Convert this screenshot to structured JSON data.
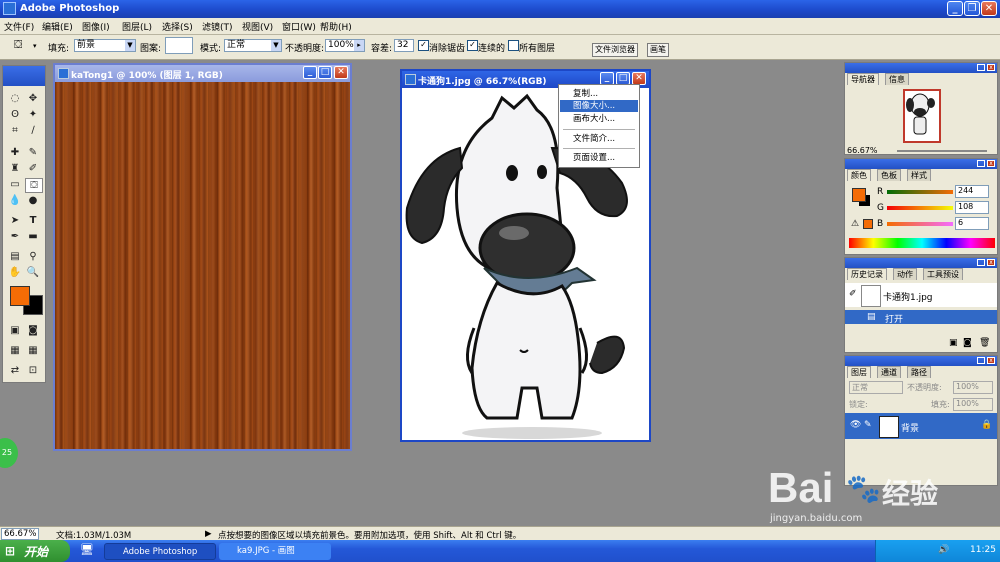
{
  "app": {
    "title": "Adobe Photoshop"
  },
  "menu": [
    "文件(F)",
    "编辑(E)",
    "图像(I)",
    "图层(L)",
    "选择(S)",
    "滤镜(T)",
    "视图(V)",
    "窗口(W)",
    "帮助(H)"
  ],
  "options": {
    "fill_label": "填充:",
    "fill_value": "前景",
    "pattern_label": "图案:",
    "mode_label": "模式:",
    "mode_value": "正常",
    "opacity_label": "不透明度:",
    "opacity_value": "100%",
    "tolerance_label": "容差:",
    "tolerance_value": "32",
    "antialias_label": "消除锯齿",
    "contiguous_label": "连续的",
    "all_layers_label": "所有图层",
    "tab_file_browser": "文件浏览器",
    "tab_brushes": "画笔"
  },
  "doc1": {
    "title": "kaTong1 @ 100% (图层 1, RGB)"
  },
  "doc2": {
    "title": "卡通狗1.jpg @ 66.7%(RGB)"
  },
  "context_menu": [
    "复制...",
    "图像大小...",
    "画布大小...",
    "文件简介...",
    "页面设置..."
  ],
  "navigator": {
    "tabs": [
      "导航器",
      "信息"
    ],
    "zoom": "66.67%"
  },
  "color": {
    "tabs": [
      "颜色",
      "色板",
      "样式"
    ],
    "r_label": "R",
    "g_label": "G",
    "b_label": "B",
    "r": "244",
    "g": "108",
    "b": "6",
    "foreground": "#f46c06"
  },
  "history": {
    "tabs": [
      "历史记录",
      "动作",
      "工具预设"
    ],
    "snapshot": "卡通狗1.jpg",
    "step": "打开"
  },
  "layers": {
    "tabs": [
      "图层",
      "通道",
      "路径"
    ],
    "blend": "正常",
    "opacity_label": "不透明度:",
    "opacity": "100%",
    "lock_label": "锁定:",
    "fill_label": "填充:",
    "fill": "100%",
    "layer_name": "背景"
  },
  "status": {
    "zoom": "66.67%",
    "doc_size": "文档:1.03M/1.03M",
    "hint": "点按想要的图像区域以填充前景色。要用附加选项，使用 Shift、Alt 和 Ctrl 键。"
  },
  "taskbar": {
    "start": "开始",
    "task1": "Adobe Photoshop",
    "task2": "ka9.JPG - 画图",
    "clock": "11:25"
  },
  "badge": "25",
  "watermark": {
    "brand": "Bai",
    "brand2": "经验",
    "url": "jingyan.baidu.com"
  }
}
